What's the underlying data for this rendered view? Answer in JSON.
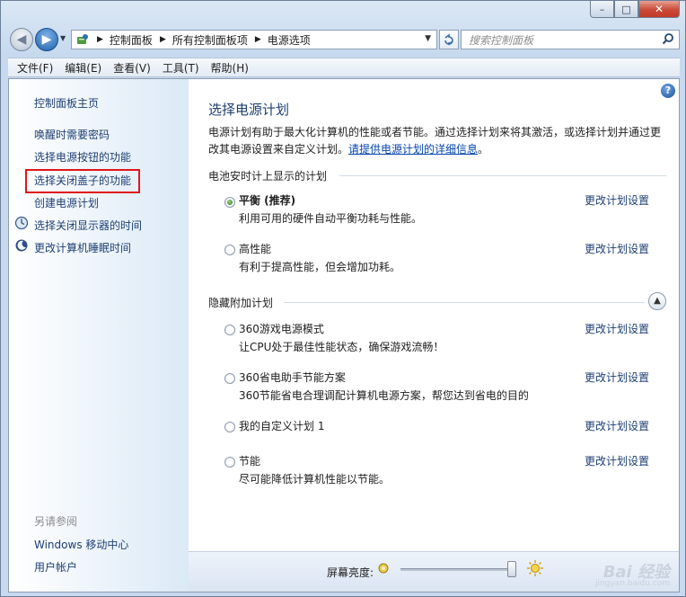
{
  "window": {
    "minimize": "–",
    "maximize": "□",
    "close": "✕"
  },
  "nav": {
    "breadcrumbs": [
      "控制面板",
      "所有控制面板项",
      "电源选项"
    ],
    "search_placeholder": "搜索控制面板"
  },
  "menu": [
    "文件(F)",
    "编辑(E)",
    "查看(V)",
    "工具(T)",
    "帮助(H)"
  ],
  "sidebar": {
    "home": "控制面板主页",
    "links": [
      "唤醒时需要密码",
      "选择电源按钮的功能",
      "选择关闭盖子的功能",
      "创建电源计划",
      "选择关闭显示器的时间",
      "更改计算机睡眠时间"
    ],
    "see_also_title": "另请参阅",
    "see_also": [
      "Windows 移动中心",
      "用户帐户"
    ]
  },
  "main": {
    "title": "选择电源计划",
    "intro": "电源计划有助于最大化计算机的性能或者节能。通过选择计划来将其激活，或选择计划并通过更改其电源设置来自定义计划。",
    "intro_link": "请提供电源计划的详细信息",
    "intro_end": "。",
    "battery_section": "电池安时计上显示的计划",
    "hidden_section": "隐藏附加计划",
    "change_link": "更改计划设置",
    "plans": [
      {
        "name": "平衡 (推荐)",
        "desc": "利用可用的硬件自动平衡功耗与性能。",
        "checked": true
      },
      {
        "name": "高性能",
        "desc": "有利于提高性能，但会增加功耗。",
        "checked": false
      },
      {
        "name": "360游戏电源模式",
        "desc": "让CPU处于最佳性能状态，确保游戏流畅！",
        "checked": false
      },
      {
        "name": "360省电助手节能方案",
        "desc": "360节能省电合理调配计算机电源方案，帮您达到省电的目的",
        "checked": false
      },
      {
        "name": "我的自定义计划 1",
        "desc": "",
        "checked": false
      },
      {
        "name": "节能",
        "desc": "尽可能降低计算机性能以节能。",
        "checked": false
      }
    ],
    "brightness_label": "屏幕亮度:",
    "brightness_level": 0.97,
    "watermark": "Bai 经验",
    "watermark_sub": "jingyan.baidu.com"
  },
  "colors": {
    "link": "#1e3f73",
    "highlight_box": "#e0161b"
  }
}
